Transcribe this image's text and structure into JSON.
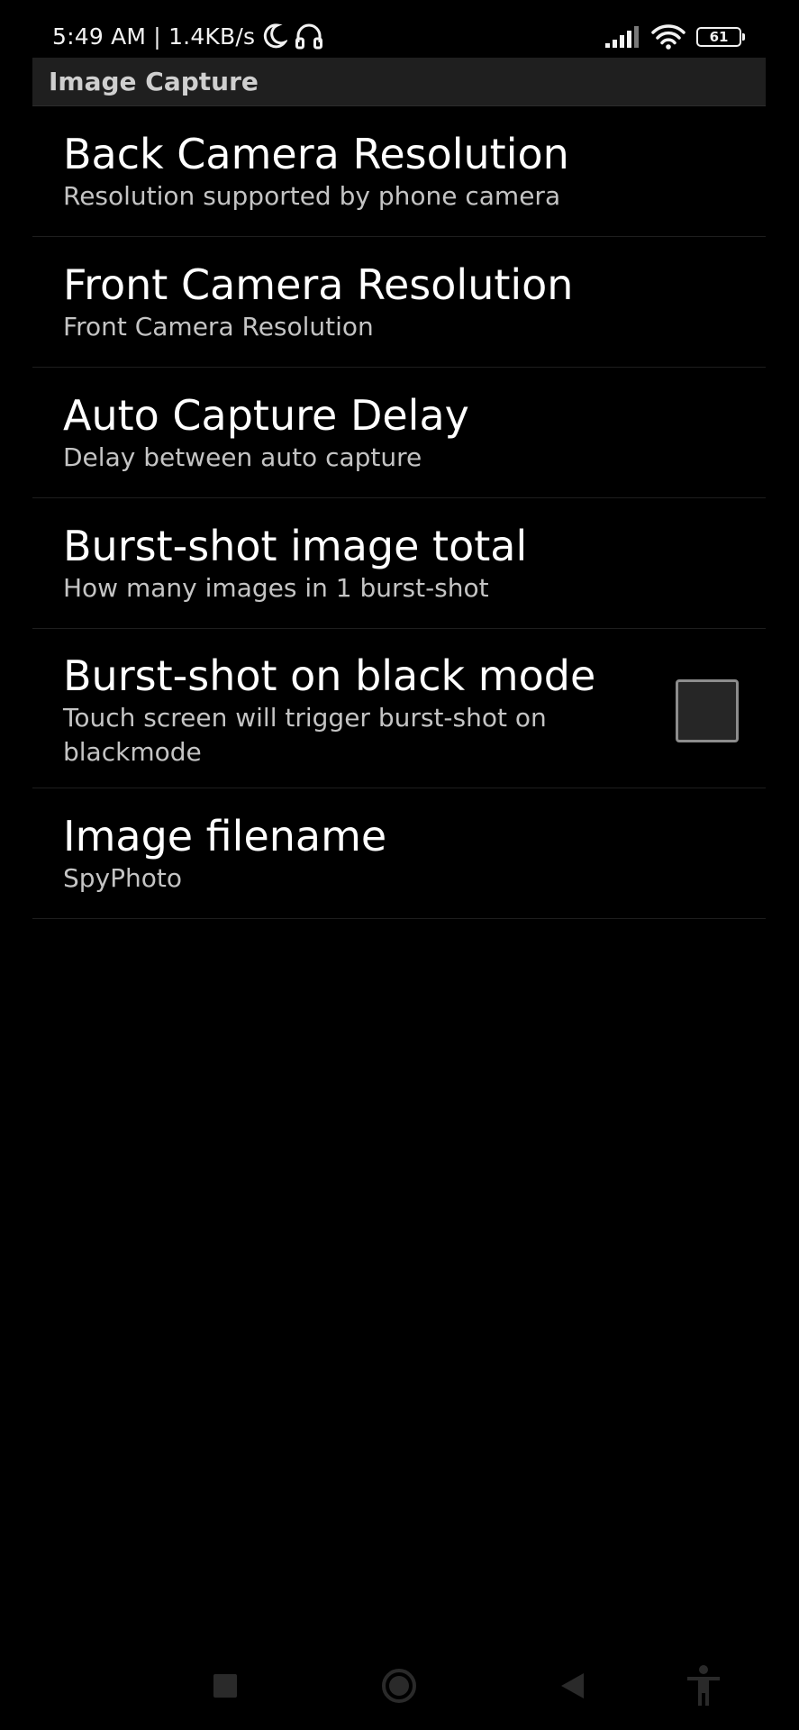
{
  "status_bar": {
    "time_speed": "5:49 AM | 1.4KB/s",
    "battery_level": "61",
    "icons": [
      "moon-icon",
      "headphones-icon",
      "signal-icon",
      "wifi-icon",
      "battery-icon"
    ]
  },
  "category": {
    "title": "Image Capture"
  },
  "preferences": [
    {
      "title": "Back Camera Resolution",
      "summary": "Resolution supported by phone camera"
    },
    {
      "title": "Front Camera Resolution",
      "summary": "Front Camera Resolution"
    },
    {
      "title": "Auto Capture Delay",
      "summary": "Delay between auto capture"
    },
    {
      "title": "Burst-shot image total",
      "summary": "How many images in 1 burst-shot"
    },
    {
      "title": "Burst-shot on black mode",
      "summary": "Touch screen will trigger burst-shot on blackmode",
      "checked": false
    },
    {
      "title": "Image filename",
      "summary": "SpyPhoto"
    }
  ],
  "nav_bar": {
    "icons": [
      "recents-square-icon",
      "home-circle-icon",
      "back-triangle-icon",
      "accessibility-icon"
    ]
  },
  "colors": {
    "background": "#000000",
    "header_background": "#1f1f1f",
    "title_text": "#ffffff",
    "summary_text": "#c4c4c4",
    "divider": "#1e1e1e"
  }
}
